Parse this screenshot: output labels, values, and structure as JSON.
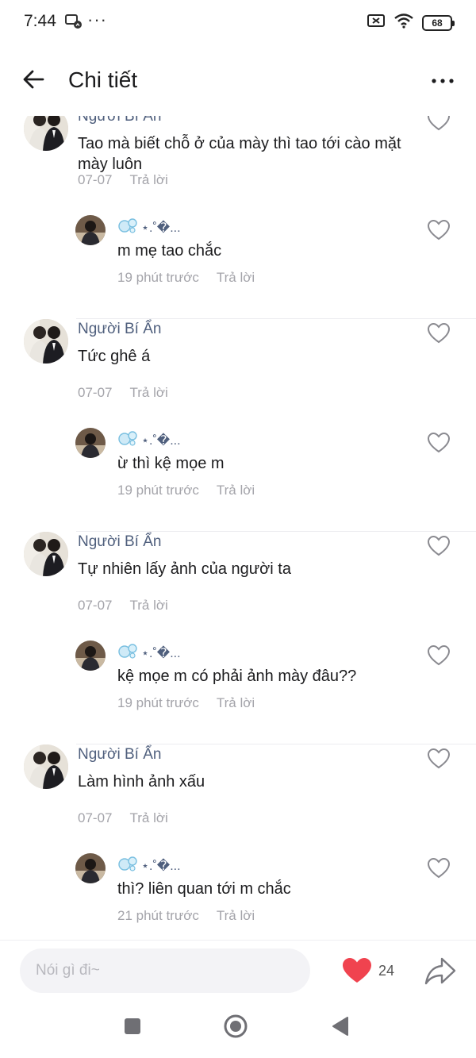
{
  "status_bar": {
    "time": "7:44",
    "dots": "···",
    "battery": "68",
    "icons": [
      "messenger-icon",
      "screen-cast-off-icon",
      "wifi-icon",
      "battery-icon"
    ]
  },
  "header": {
    "title": "Chi tiết",
    "back_icon": "arrow-left-icon",
    "more_icon": "more-horizontal-icon"
  },
  "colors": {
    "name_color": "#4f5f7d",
    "meta_color": "#a4a4aa",
    "like_red": "#f0434f",
    "input_bg": "#f3f3f6"
  },
  "threads": [
    {
      "comment": {
        "author": "Người Bí Ẩn",
        "text": "Tao mà biết chỗ ở của mày thì tao tới cào mặt mày luôn",
        "date": "07-07",
        "reply_label": "Trả lời"
      },
      "reply": {
        "author_glyphs": "⋆.˚�...",
        "text": "m mẹ tao chắc",
        "time": "19 phút trước",
        "reply_label": "Trả lời"
      }
    },
    {
      "comment": {
        "author": "Người Bí Ẩn",
        "text": "Tức ghê á",
        "date": "07-07",
        "reply_label": "Trả lời"
      },
      "reply": {
        "author_glyphs": "⋆.˚�...",
        "text": "ừ thì kệ mọe m",
        "time": "19 phút trước",
        "reply_label": "Trả lời"
      }
    },
    {
      "comment": {
        "author": "Người Bí Ẩn",
        "text": "Tự nhiên lấy ảnh của người ta",
        "date": "07-07",
        "reply_label": "Trả lời"
      },
      "reply": {
        "author_glyphs": "⋆.˚�...",
        "text": "kệ mọe m có phải ảnh mày đâu??",
        "time": "19 phút trước",
        "reply_label": "Trả lời"
      }
    },
    {
      "comment": {
        "author": "Người Bí Ẩn",
        "text": "Làm hình ảnh xấu",
        "date": "07-07",
        "reply_label": "Trả lời"
      },
      "reply": {
        "author_glyphs": "⋆.˚�...",
        "text": "thì? liên quan tới m chắc",
        "time": "21 phút trước",
        "reply_label": "Trả lời"
      }
    }
  ],
  "bottom_bar": {
    "input_placeholder": "Nói gì đi~",
    "like_count": "24",
    "heart_icon": "heart-filled-icon",
    "share_icon": "share-icon"
  },
  "nav_bar": {
    "icons": [
      "recents-square-icon",
      "home-circle-icon",
      "back-triangle-icon"
    ]
  }
}
